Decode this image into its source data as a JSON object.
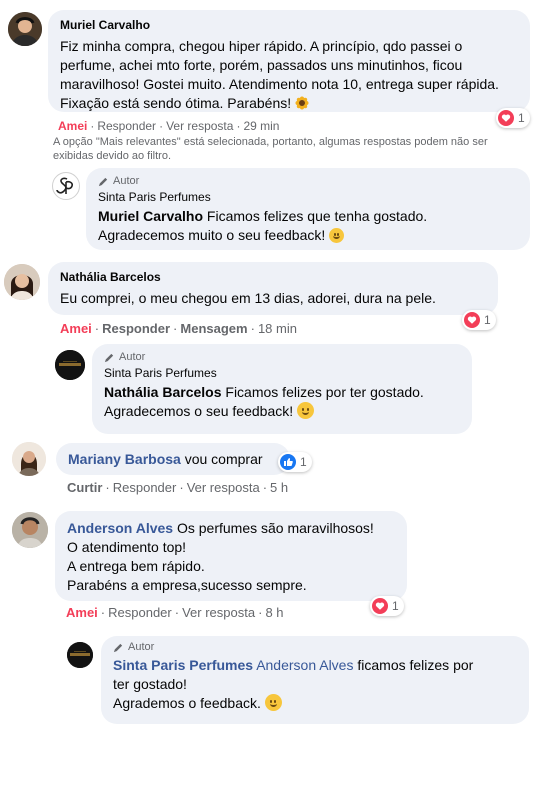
{
  "comments": [
    {
      "author": "Muriel Carvalho",
      "text": "Fiz minha compra, chegou hiper rápido. A princípio, qdo passei o perfume, achei mto forte, porém, passados uns minutinhos, ficou maravilhoso! Gostei muito. Atendimento nota 10, entrega super rápida. Fixação está sendo ótima. Parabéns!",
      "emoji": "sunflower",
      "reaction_count": "1",
      "reaction_icon": "heart-icon",
      "actions": {
        "react": "Amei",
        "reply": "Responder",
        "more": "Ver resposta",
        "time": "29 min"
      },
      "filter_notice": "A opção \"Mais relevantes\" está selecionada, portanto, algumas respostas podem não ser exibidas devido ao filtro.",
      "reply": {
        "badge": "Autor",
        "page": "Sinta Paris Perfumes",
        "mention": "Muriel Carvalho",
        "text": "Ficamos felizes que tenha gostado.\nAgradecemos muito o seu feedback!",
        "emoji": "smile"
      }
    },
    {
      "author": "Nathália Barcelos",
      "text": "Eu comprei, o meu chegou em 13 dias, adorei, dura na pele.",
      "reaction_count": "1",
      "reaction_icon": "heart-icon",
      "actions": {
        "react": "Amei",
        "reply": "Responder",
        "more": "Mensagem",
        "time": "18 min"
      },
      "reply": {
        "badge": "Autor",
        "page": "Sinta Paris Perfumes",
        "mention": "Nathália Barcelos",
        "text": "Ficamos felizes por ter gostado.\nAgradecemos o seu feedback!",
        "emoji": "smile"
      }
    },
    {
      "author": "Mariany Barbosa",
      "text": "vou comprar",
      "reaction_count": "1",
      "reaction_icon": "like-icon",
      "actions": {
        "react": "Curtir",
        "reply": "Responder",
        "more": "Ver resposta",
        "time": "5 h"
      }
    },
    {
      "author": "Anderson Alves",
      "text": "Os perfumes são maravilhosos!\nO atendimento top!\nA entrega bem rápido.\nParabéns a empresa,sucesso sempre.",
      "reaction_count": "1",
      "reaction_icon": "heart-icon",
      "actions": {
        "react": "Amei",
        "reply": "Responder",
        "more": "Ver resposta",
        "time": "8 h"
      },
      "reply": {
        "badge": "Autor",
        "page": "Sinta Paris Perfumes",
        "mention": "Anderson Alves",
        "text": "ficamos felizes por\nter gostado!\nAgrademos o feedback.",
        "emoji": "smile"
      }
    }
  ],
  "colors": {
    "bubble": "#eef1f7",
    "love": "#f33e58",
    "link": "#385898",
    "like": "#1877f2"
  }
}
